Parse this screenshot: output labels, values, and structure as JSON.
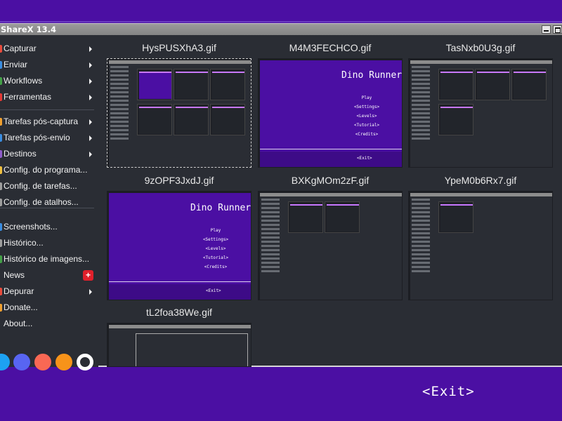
{
  "window": {
    "title": "ShareX 13.4"
  },
  "sidebar": {
    "items": [
      {
        "label": "Capturar",
        "arrow": true,
        "icon_color": "#e84b3c"
      },
      {
        "label": "Enviar",
        "arrow": true,
        "icon_color": "#3b8de0"
      },
      {
        "label": "Workflows",
        "arrow": true,
        "icon_color": "#43a047"
      },
      {
        "label": "Ferramentas",
        "arrow": true,
        "icon_color": "#e53935"
      },
      {
        "label": "Tarefas pós-captura",
        "arrow": true,
        "icon_color": "#f0a030"
      },
      {
        "label": "Tarefas pós-envio",
        "arrow": true,
        "icon_color": "#3b8de0"
      },
      {
        "label": "Destinos",
        "arrow": true,
        "icon_color": "#8e5cc9"
      },
      {
        "label": "Config. do programa...",
        "arrow": false,
        "icon_color": "#f0c040"
      },
      {
        "label": "Config. de tarefas...",
        "arrow": false,
        "icon_color": "#9e9e9e"
      },
      {
        "label": "Config. de atalhos...",
        "arrow": false,
        "icon_color": "#9e9e9e"
      },
      {
        "label": "Screenshots...",
        "arrow": false,
        "icon_color": "#3b8de0"
      },
      {
        "label": "Histórico...",
        "arrow": false,
        "icon_color": "#9e9e9e"
      },
      {
        "label": "Histórico de imagens...",
        "arrow": false,
        "icon_color": "#43a047"
      },
      {
        "label": "News",
        "arrow": false,
        "icon_color": "#2a2d34",
        "badge": "+"
      },
      {
        "label": "Depurar",
        "arrow": true,
        "icon_color": "#e84b3c"
      },
      {
        "label": "Donate...",
        "arrow": false,
        "icon_color": "#f0a030"
      },
      {
        "label": "About...",
        "arrow": false,
        "icon_color": "#2a2d34"
      }
    ],
    "social": [
      {
        "name": "twitter-icon",
        "color": "#1da1f2"
      },
      {
        "name": "discord-icon",
        "color": "#5865f2"
      },
      {
        "name": "patreon-icon",
        "color": "#f96854"
      },
      {
        "name": "bitcoin-icon",
        "color": "#f7931a"
      },
      {
        "name": "github-icon",
        "color": "#ffffff"
      }
    ]
  },
  "thumbnails": [
    {
      "filename": "HysPUSXhA3.gif",
      "kind": "app",
      "selected": true
    },
    {
      "filename": "M4M3FECHCO.gif",
      "kind": "dino-partial",
      "selected": false
    },
    {
      "filename": "TasNxb0U3g.gif",
      "kind": "app",
      "selected": false
    },
    {
      "filename": "9zOPF3JxdJ.gif",
      "kind": "dino-full",
      "selected": false
    },
    {
      "filename": "BXKgMOm2zF.gif",
      "kind": "app",
      "selected": false
    },
    {
      "filename": "YpeM0b6Rx7.gif",
      "kind": "app",
      "selected": false
    },
    {
      "filename": "tL2foa38We.gif",
      "kind": "app-table",
      "selected": false
    }
  ],
  "dino_game": {
    "title": "Dino Runner",
    "options": [
      "Play",
      "<Settings>",
      "<Levels>",
      "<Tutorial>",
      "<Credits>"
    ],
    "exit_small": "<Exit>"
  },
  "overlay": {
    "exit_label": "<Exit>"
  },
  "colors": {
    "game_bg": "#4b0fa3",
    "app_bg": "#2a2d34",
    "accent": "#c878ff"
  }
}
